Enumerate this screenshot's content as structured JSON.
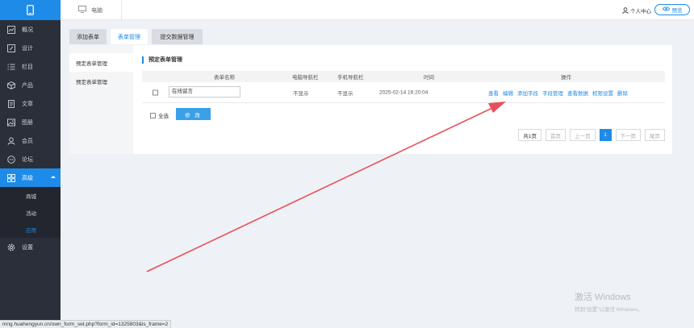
{
  "sidebar": {
    "items": [
      {
        "label": "概况",
        "icon": "dashboard-icon"
      },
      {
        "label": "设计",
        "icon": "palette-icon"
      },
      {
        "label": "栏目",
        "icon": "list-icon"
      },
      {
        "label": "产品",
        "icon": "cube-icon"
      },
      {
        "label": "文章",
        "icon": "document-icon"
      },
      {
        "label": "图册",
        "icon": "image-icon"
      },
      {
        "label": "会员",
        "icon": "user-icon"
      },
      {
        "label": "论坛",
        "icon": "forum-icon"
      },
      {
        "label": "高级",
        "icon": "grid-icon"
      }
    ],
    "sub_items": [
      {
        "label": "商城"
      },
      {
        "label": "活动"
      },
      {
        "label": "应用"
      }
    ],
    "settings": {
      "label": "设置",
      "icon": "gear-icon"
    }
  },
  "topbar": {
    "device_label": "电脑",
    "user_center": "个人中心",
    "preview": "预览"
  },
  "tabs": [
    {
      "label": "添加表单"
    },
    {
      "label": "表单管理"
    },
    {
      "label": "提交数据管理"
    }
  ],
  "left_menu": [
    {
      "label": "预定表单管理"
    },
    {
      "label": "预定表单管理"
    }
  ],
  "section_title": "预定表单管理",
  "table": {
    "headers": [
      "表单名称",
      "电脑导航栏",
      "手机导航栏",
      "时间",
      "操作"
    ],
    "rows": [
      {
        "name": "在线留言",
        "pc_nav": "不显示",
        "mobile_nav": "不显示",
        "time": "2025-02-14 16:20:04",
        "actions": [
          "查看",
          "编辑",
          "添加字段",
          "字段管理",
          "查看数据",
          "权限设置",
          "删除"
        ]
      }
    ]
  },
  "select_all": "全选",
  "modify_button": "修 改",
  "pager": {
    "total": "共1页",
    "first": "首页",
    "prev": "上一页",
    "current": "1",
    "next": "下一页",
    "last": "尾页"
  },
  "statusbar": "mng.huahengyun.cn/own_form_set.php?form_id=1325803&is_frame=2",
  "watermark": {
    "title": "激活 Windows",
    "subtitle": "转到“设置”以激活 Windows。"
  },
  "colors": {
    "accent": "#1e8be8",
    "sidebar_bg": "#2b2f3a",
    "arrow": "#e8505b"
  }
}
